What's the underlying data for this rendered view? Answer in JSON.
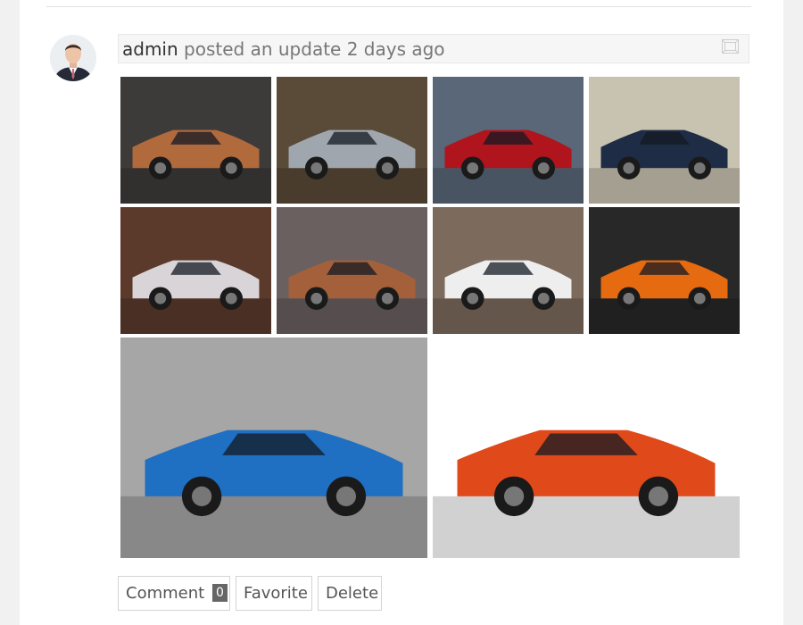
{
  "activity": {
    "author": "admin",
    "action_text": "posted an update",
    "time_ago": "2 days ago",
    "expand_icon": "expand-icon"
  },
  "gallery": {
    "photos": [
      {
        "name": "photo-orange-roadster",
        "body": "#b06a3c",
        "bg": "#3d3a3a"
      },
      {
        "name": "photo-silver-gullwing",
        "body": "#9fa6ad",
        "bg": "#5a4a38"
      },
      {
        "name": "photo-red-supercar",
        "body": "#b0141c",
        "bg": "#5a6778"
      },
      {
        "name": "photo-blue-hypercar",
        "body": "#1e2c46",
        "bg": "#c8c3b0"
      },
      {
        "name": "photo-white-coupe",
        "body": "#d8d4d8",
        "bg": "#5b3a2c"
      },
      {
        "name": "photo-copper-roadster-doors",
        "body": "#a3603a",
        "bg": "#6a6060"
      },
      {
        "name": "photo-white-sports-car",
        "body": "#eeeeee",
        "bg": "#7c6a5c"
      },
      {
        "name": "photo-orange-track-car",
        "body": "#e66a10",
        "bg": "#282828"
      },
      {
        "name": "photo-blue-convertible",
        "body": "#1f6fc2",
        "bg": "#a6a6a6"
      },
      {
        "name": "photo-orange-hypercar-doors",
        "body": "#e04a1a",
        "bg": "#ffffff"
      }
    ]
  },
  "actions": {
    "comment_label": "Comment",
    "comment_count": "0",
    "favorite_label": "Favorite",
    "delete_label": "Delete"
  }
}
